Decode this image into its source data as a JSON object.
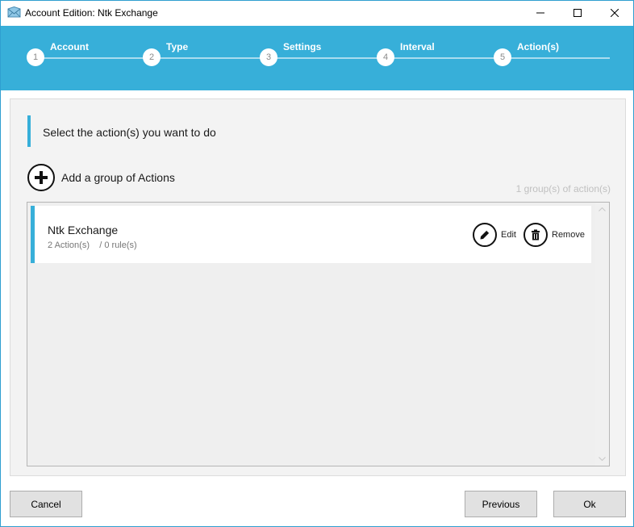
{
  "window": {
    "title": "Account Edition: Ntk Exchange",
    "icon": "mail-envelope-icon"
  },
  "steps": [
    {
      "number": "1",
      "label": "Account"
    },
    {
      "number": "2",
      "label": "Type"
    },
    {
      "number": "3",
      "label": "Settings"
    },
    {
      "number": "4",
      "label": "Interval"
    },
    {
      "number": "5",
      "label": "Action(s)"
    }
  ],
  "content": {
    "instruction": "Select the action(s) you want to do",
    "add_group_label": "Add a group of Actions",
    "group_count": "1 group(s) of action(s)"
  },
  "groups": [
    {
      "name": "Ntk Exchange",
      "actions_count": "2",
      "actions_label": "Action(s)",
      "separator": "/",
      "rules_count": "0",
      "rules_label": "rule(s)",
      "edit_label": "Edit",
      "remove_label": "Remove"
    }
  ],
  "footer": {
    "cancel_label": "Cancel",
    "previous_label": "Previous",
    "ok_label": "Ok"
  },
  "colors": {
    "accent": "#37afd9",
    "panel_bg": "#f3f3f3",
    "button_bg": "#e1e1e1"
  }
}
